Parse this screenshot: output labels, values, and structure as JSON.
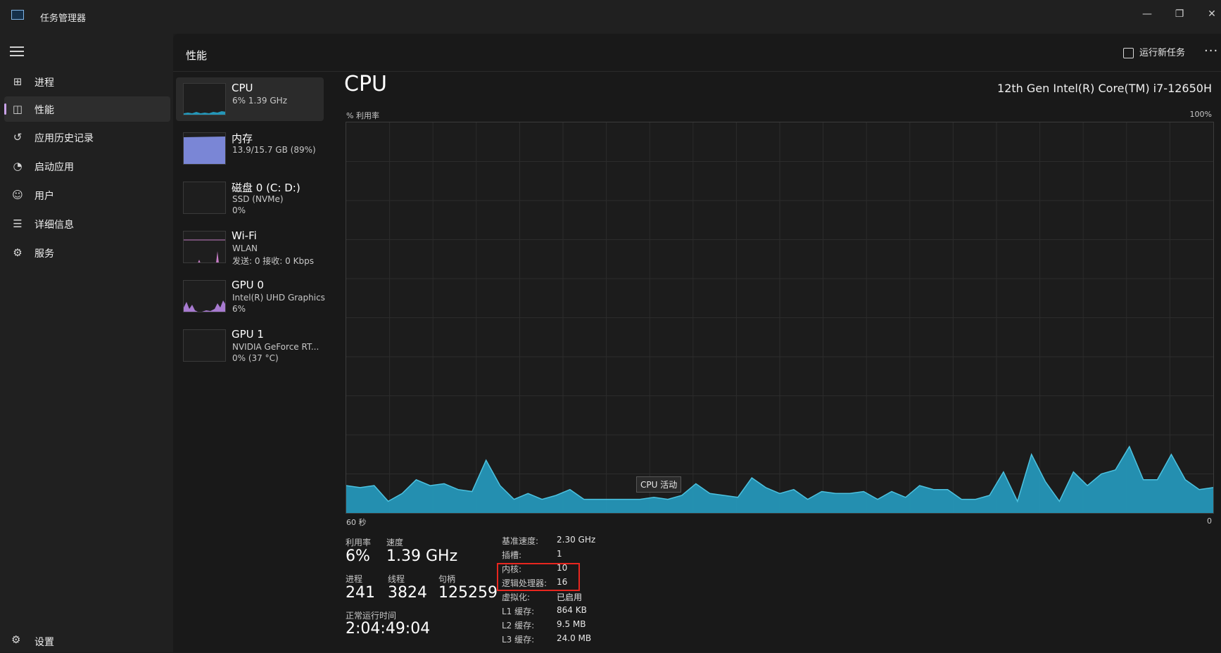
{
  "window": {
    "title": "任务管理器",
    "minimize_label": "—",
    "restore_label": "❐",
    "close_label": "✕"
  },
  "nav": {
    "items": [
      {
        "label": "进程",
        "icon": "processes-icon"
      },
      {
        "label": "性能",
        "icon": "performance-icon"
      },
      {
        "label": "应用历史记录",
        "icon": "history-icon"
      },
      {
        "label": "启动应用",
        "icon": "startup-icon"
      },
      {
        "label": "用户",
        "icon": "users-icon"
      },
      {
        "label": "详细信息",
        "icon": "details-icon"
      },
      {
        "label": "服务",
        "icon": "services-icon"
      }
    ],
    "settings_label": "设置",
    "accent": "#c9a2e8"
  },
  "header": {
    "title": "性能",
    "run_task_label": "运行新任务",
    "more_label": "···"
  },
  "devices": [
    {
      "name": "CPU",
      "line1": "6% 1.39 GHz",
      "line2": ""
    },
    {
      "name": "内存",
      "line1": "13.9/15.7 GB (89%)",
      "line2": ""
    },
    {
      "name": "磁盘 0 (C: D:)",
      "line1": "SSD (NVMe)",
      "line2": "0%"
    },
    {
      "name": "Wi-Fi",
      "line1": "WLAN",
      "line2": "发送: 0 接收: 0 Kbps"
    },
    {
      "name": "GPU 0",
      "line1": "Intel(R) UHD Graphics",
      "line2": "6%"
    },
    {
      "name": "GPU 1",
      "line1": "NVIDIA GeForce RT...",
      "line2": "0% (37 °C)"
    }
  ],
  "cpu": {
    "title": "CPU",
    "model": "12th Gen Intel(R) Core(TM) i7-12650H",
    "util_label": "% 利用率",
    "max_label": "100%",
    "time_start": "60 秒",
    "time_end": "0",
    "tooltip": "CPU 活动",
    "graph_color": "#2596b8",
    "history": [
      7,
      6.5,
      7,
      3,
      5,
      8.5,
      7,
      7.5,
      6,
      5.5,
      13.5,
      7,
      3.5,
      5,
      3.5,
      4.5,
      6,
      3.5,
      3.5,
      3.5,
      3.5,
      3.5,
      4,
      3.5,
      4.5,
      7.5,
      5,
      4.5,
      4,
      9,
      6.5,
      5,
      6,
      3.5,
      5.5,
      5,
      5,
      5.5,
      3.5,
      5.5,
      4,
      7,
      6,
      6,
      3.5,
      3.5,
      4.5,
      10.5,
      3,
      15,
      8,
      3,
      10.5,
      7,
      10,
      11,
      17,
      8.5,
      8.5,
      15,
      8.5,
      6,
      6.5
    ],
    "stats": {
      "utilization_label": "利用率",
      "utilization_value": "6%",
      "speed_label": "速度",
      "speed_value": "1.39 GHz",
      "processes_label": "进程",
      "processes_value": "241",
      "threads_label": "线程",
      "threads_value": "3824",
      "handles_label": "句柄",
      "handles_value": "125259",
      "uptime_label": "正常运行时间",
      "uptime_value": "2:04:49:04"
    },
    "specs": [
      {
        "label": "基准速度:",
        "value": "2.30 GHz"
      },
      {
        "label": "插槽:",
        "value": "1"
      },
      {
        "label": "内核:",
        "value": "10"
      },
      {
        "label": "逻辑处理器:",
        "value": "16"
      },
      {
        "label": "虚拟化:",
        "value": "已启用"
      },
      {
        "label": "L1 缓存:",
        "value": "864 KB"
      },
      {
        "label": "L2 缓存:",
        "value": "9.5 MB"
      },
      {
        "label": "L3 缓存:",
        "value": "24.0 MB"
      }
    ]
  }
}
